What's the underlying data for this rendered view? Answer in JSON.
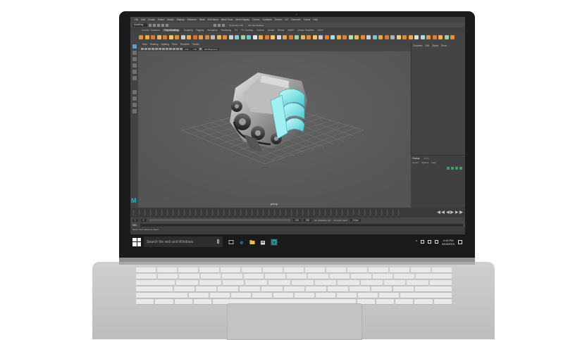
{
  "maya": {
    "menubar": [
      "File",
      "Edit",
      "Create",
      "Select",
      "Modify",
      "Display",
      "Windows",
      "Mesh",
      "Edit Mesh",
      "Mesh Tools",
      "Mesh Display",
      "Curves",
      "Surfaces",
      "Deform",
      "UV",
      "Generate",
      "Cache",
      "Help"
    ],
    "mode": "Modeling",
    "symmetry": "Symmetry: Off",
    "no_live_surface": "No Live Surface",
    "shelf_tabs": [
      "Curves / Surfaces",
      "Poly Modeling",
      "Sculpting",
      "Rigging",
      "Animation",
      "Rendering",
      "FX",
      "FX Caching",
      "Custom",
      "Arnold",
      "Bifrost",
      "MASH",
      "Motion Graphics",
      "XGen"
    ],
    "active_shelf_tab": "Poly Modeling",
    "viewport_menu": [
      "View",
      "Shading",
      "Lighting",
      "Show",
      "Renderer",
      "Panels"
    ],
    "viewport_fields": {
      "near": "0.00",
      "far": "1.00",
      "colorspace": "sRGB gamma"
    },
    "camera_label": "persp",
    "channel_box_menu": [
      "Channels",
      "Edit",
      "Object",
      "Show"
    ],
    "layer_tabs": [
      "Display",
      "Anim"
    ],
    "layer_menu": [
      "Layers",
      "Options",
      "Help"
    ],
    "range": {
      "start": "120",
      "end": "200",
      "current": "24 fps"
    },
    "character_set": "No Character Set",
    "anim_layer": "No Anim Layer",
    "cmd_label": "MEL",
    "help_text": "Select Tool: select an object",
    "logo": "M"
  },
  "taskbar": {
    "search_placeholder": "Search the web and Windows",
    "time": "4:15 PM",
    "date": "6/10/2015"
  },
  "colors": {
    "maya_accent": "#23b7c4",
    "engine_accent": "#6fe3e8",
    "taskbar": "#1a1a1a"
  }
}
